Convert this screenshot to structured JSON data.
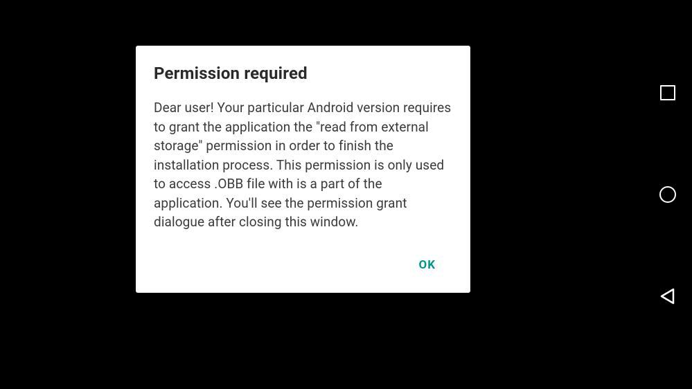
{
  "dialog": {
    "title": "Permission required",
    "message": "Dear user! Your particular Android version requires to grant the application the \"read from external storage\" permission in order to finish the installation process. This permission is only used to access .OBB file with is a part of the application. You'll see the permission grant dialogue after closing this window.",
    "ok_label": "OK"
  },
  "navbar": {
    "recent_apps": "recent-apps",
    "home": "home",
    "back": "back"
  },
  "colors": {
    "accent": "#009688",
    "background": "#000000",
    "dialog_bg": "#ffffff"
  }
}
